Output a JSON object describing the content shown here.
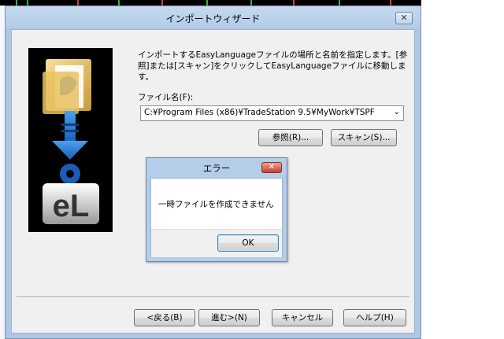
{
  "wizard": {
    "title": "インポートウィザード",
    "close_label": "✕",
    "instructions": "インポートするEasyLanguageファイルの場所と名前を指定します。[参照]または[スキャン]をクリックしてEasyLanguageファイルに移動します。",
    "file_name_label": "ファイル名(F):",
    "file_name_value": "C:¥Program Files (x86)¥TradeStation 9.5¥MyWork¥TSPF",
    "dropdown_icon": "chevron-down-icon",
    "browse_button": "参照(R)...",
    "scan_button": "スキャン(S)...",
    "back_button": "<戻る(B)",
    "next_button": "進む>(N)",
    "cancel_button": "キャンセル",
    "help_button": "ヘルプ(H)"
  },
  "side_image": {
    "logo_text": "eL",
    "icons": [
      "folder-icon",
      "arrow-down-icon",
      "gear-icon"
    ]
  },
  "error_dialog": {
    "title": "エラー",
    "close_label": "✕",
    "message": "一時ファイルを作成できません",
    "ok_button": "OK"
  },
  "colors": {
    "window_frame": "#aec8e4",
    "dialog_bg": "#f0f0f0",
    "close_red": "#c7402d",
    "logo_blue": "#1a5db8"
  }
}
